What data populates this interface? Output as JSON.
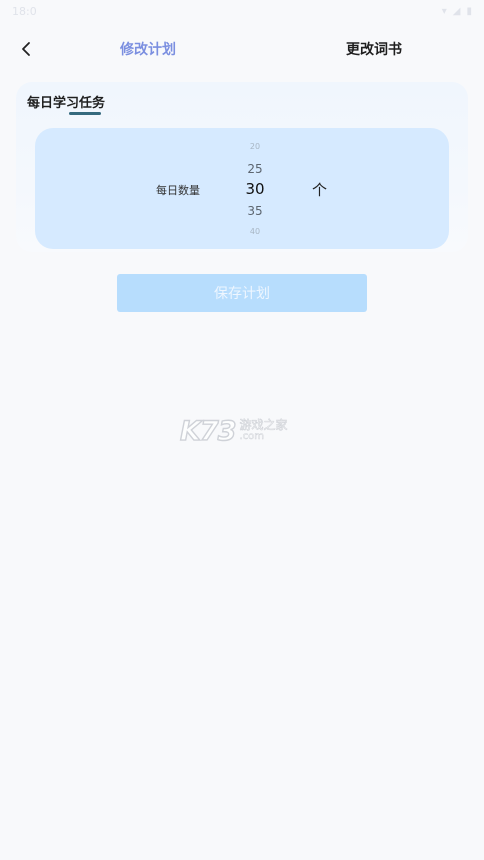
{
  "status_bar": {
    "time": "18:0",
    "icons": [
      "wifi-icon",
      "signal-icon",
      "battery-icon"
    ]
  },
  "nav": {
    "back_icon": "chevron-left-icon",
    "tab_plan": "修改计划",
    "tab_book": "更改词书"
  },
  "card": {
    "title": "每日学习任务",
    "picker": {
      "label": "每日数量",
      "options": [
        "20",
        "25",
        "30",
        "35",
        "40"
      ],
      "selected": "30",
      "unit": "个"
    }
  },
  "save_button": {
    "label": "保存计划"
  },
  "watermark": {
    "logo": "K73",
    "top": "游戏之家",
    "bottom": ".com"
  },
  "colors": {
    "accent_tab": "#7b8fe0",
    "picker_bg": "#d6eaff",
    "save_bg": "#b7ddfd",
    "underline": "#356a7e"
  }
}
